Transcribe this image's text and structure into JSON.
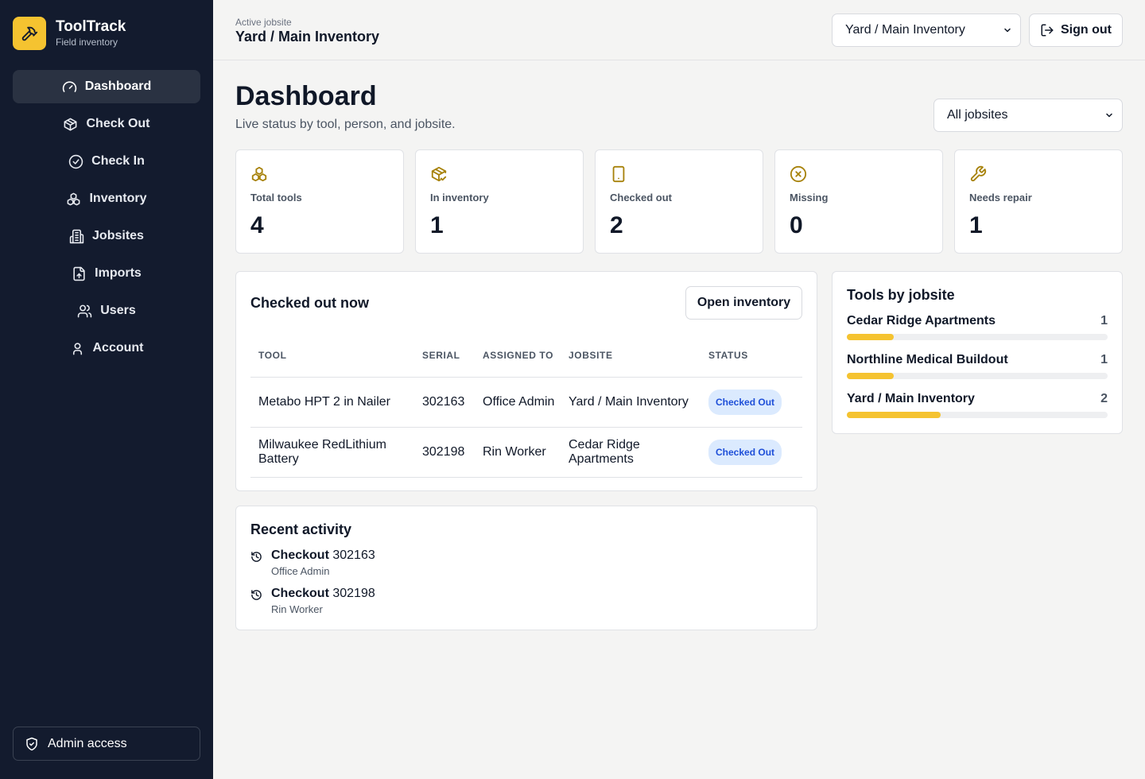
{
  "brand": {
    "name": "ToolTrack",
    "subtitle": "Field inventory"
  },
  "nav": [
    {
      "label": "Dashboard",
      "icon": "gauge-icon",
      "active": true
    },
    {
      "label": "Check Out",
      "icon": "package-icon"
    },
    {
      "label": "Check In",
      "icon": "check-circle-icon"
    },
    {
      "label": "Inventory",
      "icon": "boxes-icon"
    },
    {
      "label": "Jobsites",
      "icon": "building-icon"
    },
    {
      "label": "Imports",
      "icon": "file-upload-icon"
    },
    {
      "label": "Users",
      "icon": "users-icon"
    },
    {
      "label": "Account",
      "icon": "user-icon"
    }
  ],
  "admin": {
    "label": "Admin access",
    "icon": "shield-check-icon"
  },
  "topbar": {
    "active_label": "Active jobsite",
    "active_value": "Yard / Main Inventory",
    "jobsite_select": "Yard / Main Inventory",
    "signout_label": "Sign out"
  },
  "page": {
    "title": "Dashboard",
    "subtitle": "Live status by tool, person, and jobsite.",
    "filter_select": "All jobsites"
  },
  "stats": [
    {
      "label": "Total tools",
      "value": "4",
      "icon": "boxes-icon"
    },
    {
      "label": "In inventory",
      "value": "1",
      "icon": "package-check-icon"
    },
    {
      "label": "Checked out",
      "value": "2",
      "icon": "tablet-icon"
    },
    {
      "label": "Missing",
      "value": "0",
      "icon": "x-circle-icon"
    },
    {
      "label": "Needs repair",
      "value": "1",
      "icon": "wrench-icon"
    }
  ],
  "checked_out": {
    "title": "Checked out now",
    "open_label": "Open inventory",
    "columns": [
      "TOOL",
      "SERIAL",
      "ASSIGNED TO",
      "JOBSITE",
      "STATUS"
    ],
    "rows": [
      {
        "tool": "Metabo HPT 2 in Nailer",
        "serial": "302163",
        "assigned": "Office Admin",
        "jobsite": "Yard / Main Inventory",
        "status": "Checked Out"
      },
      {
        "tool": "Milwaukee RedLithium Battery",
        "serial": "302198",
        "assigned": "Rin Worker",
        "jobsite": "Cedar Ridge Apartments",
        "status": "Checked Out"
      }
    ]
  },
  "activity": {
    "title": "Recent activity",
    "items": [
      {
        "action": "Checkout",
        "serial": "302163",
        "user": "Office Admin"
      },
      {
        "action": "Checkout",
        "serial": "302198",
        "user": "Rin Worker"
      }
    ]
  },
  "by_jobsite": {
    "title": "Tools by jobsite",
    "items": [
      {
        "name": "Cedar Ridge Apartments",
        "count": "1",
        "fraction": 0.18
      },
      {
        "name": "Northline Medical Buildout",
        "count": "1",
        "fraction": 0.18
      },
      {
        "name": "Yard / Main Inventory",
        "count": "2",
        "fraction": 0.36
      }
    ]
  },
  "colors": {
    "sidebar": "#131b2e",
    "accent": "#f5c330",
    "badge_bg": "#dbeafe",
    "badge_text": "#1d4ed8"
  }
}
